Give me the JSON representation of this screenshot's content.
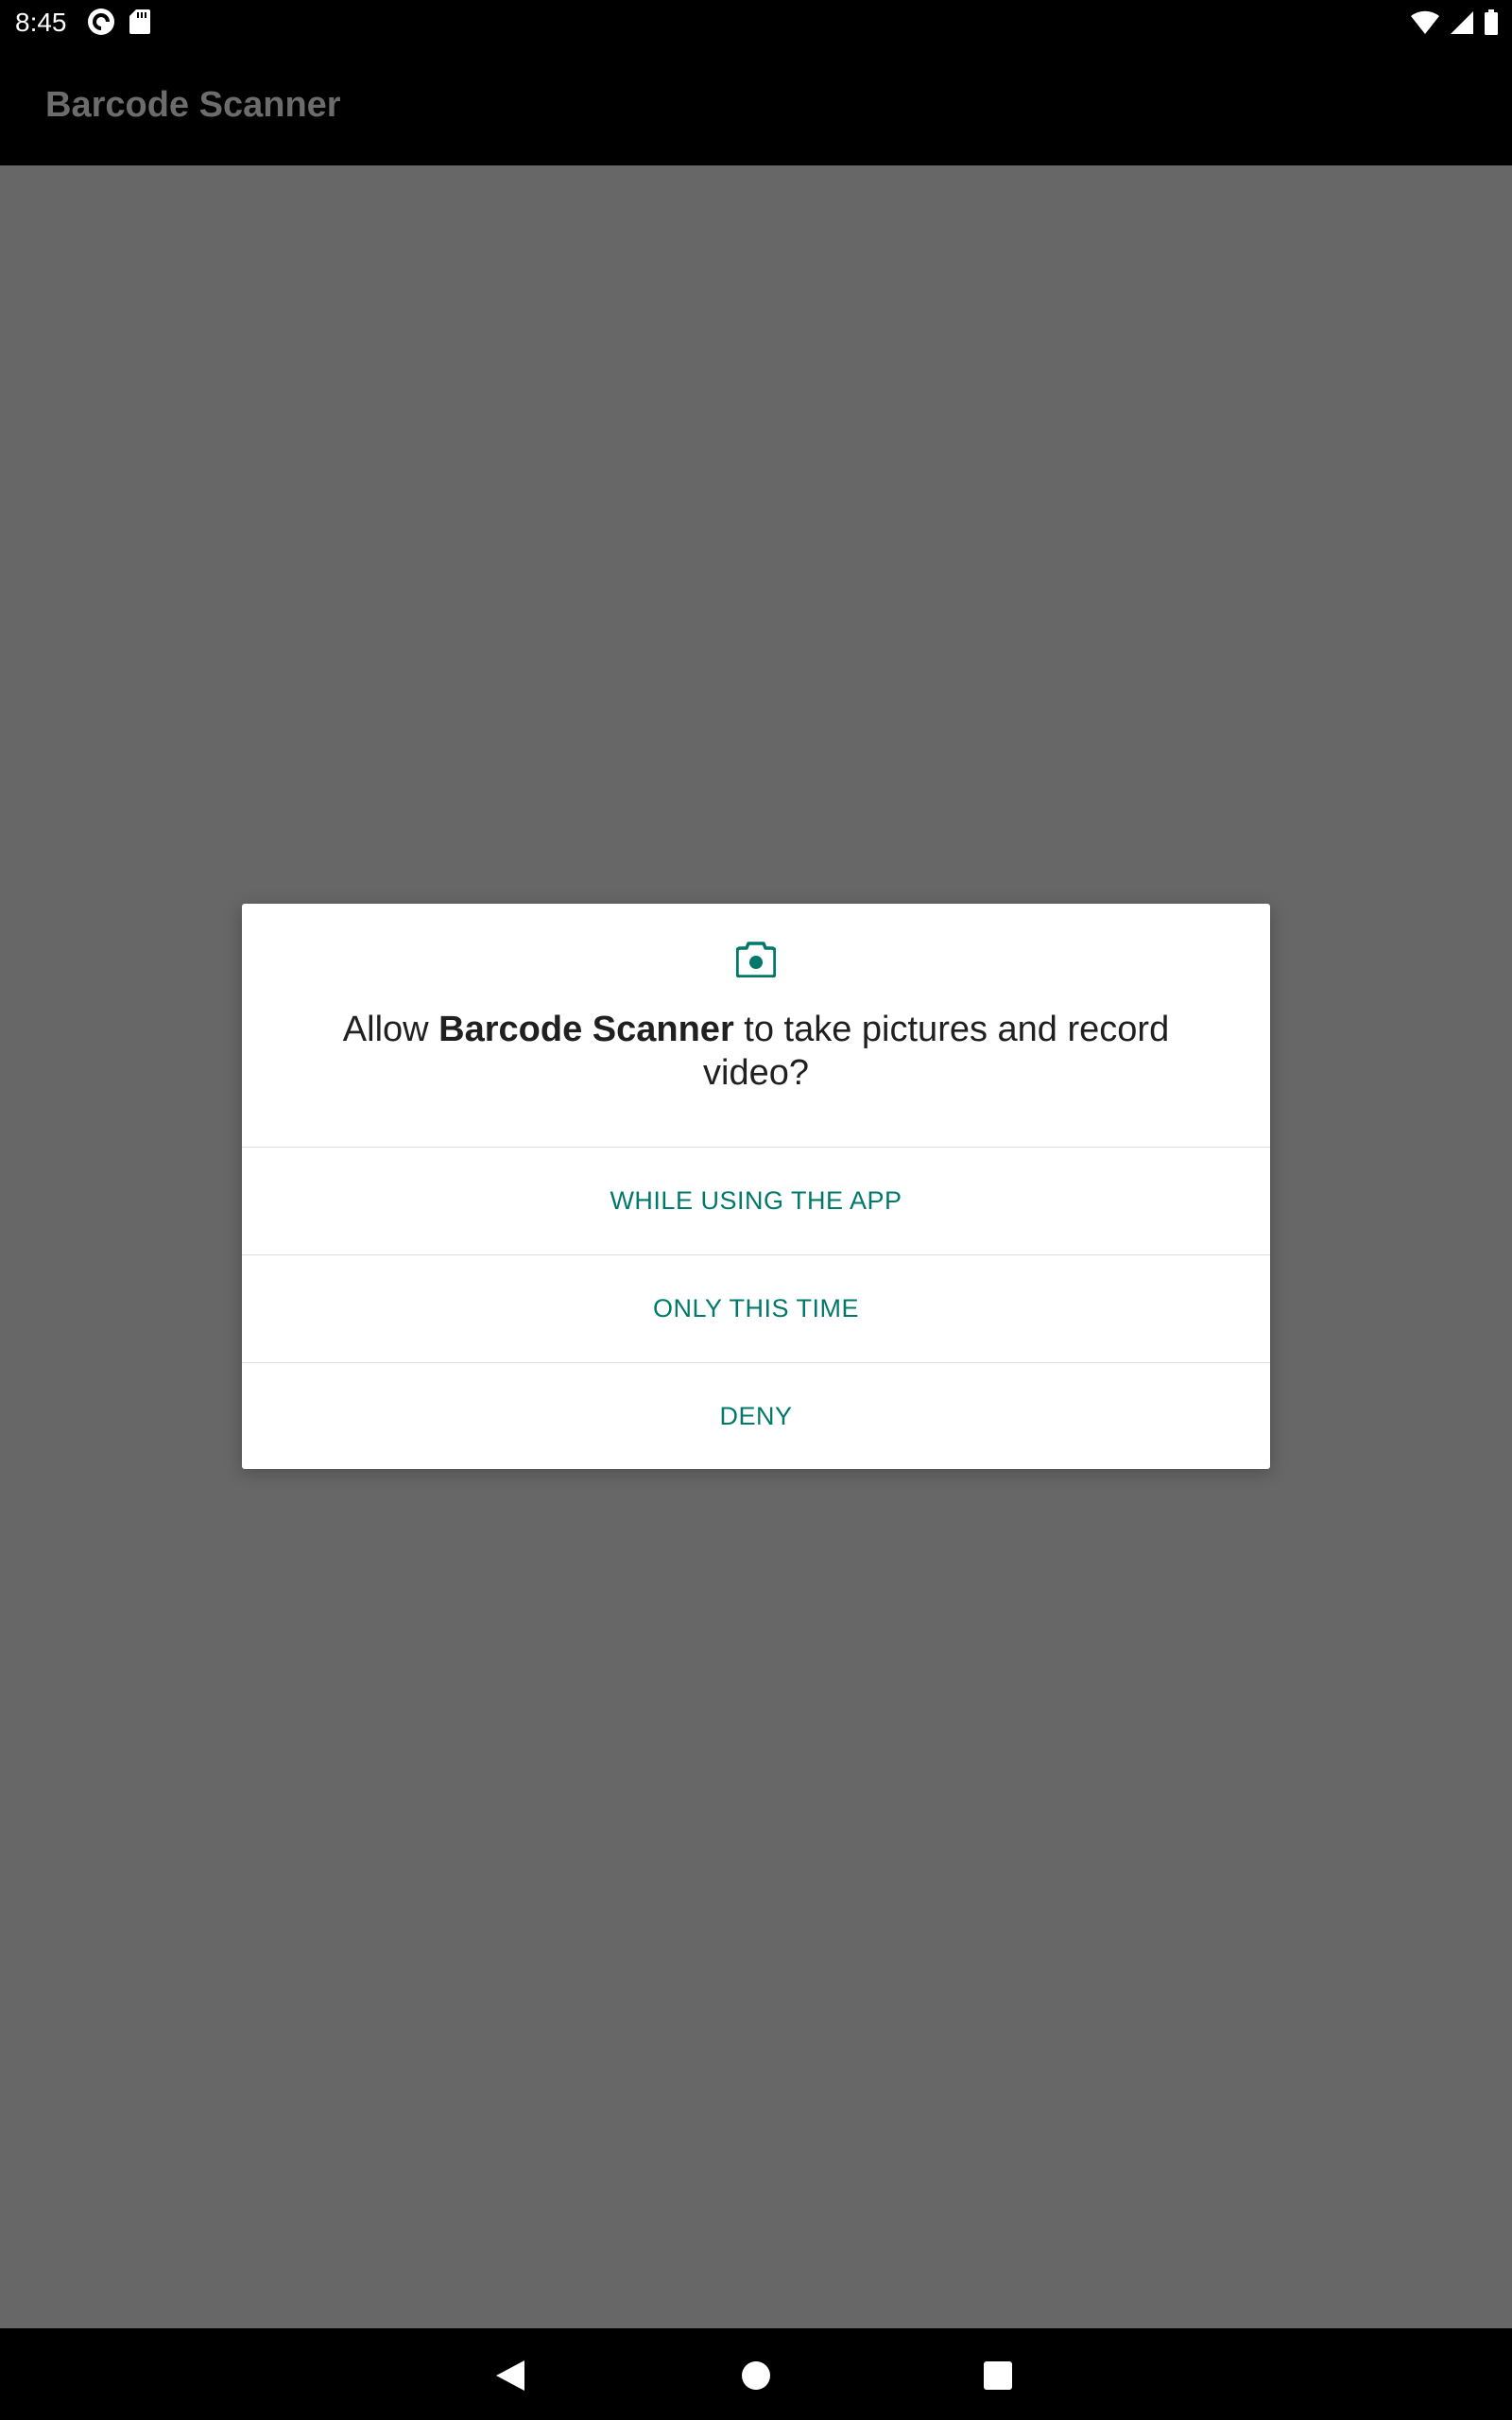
{
  "status_bar": {
    "time": "8:45",
    "left_icons": [
      "pocket-casts-icon",
      "sd-card-icon"
    ],
    "right_icons": [
      "wifi-icon",
      "signal-icon",
      "battery-icon"
    ]
  },
  "app_bar": {
    "title": "Barcode Scanner"
  },
  "dialog": {
    "icon": "camera-icon",
    "message_prefix": "Allow ",
    "message_app": "Barcode Scanner",
    "message_suffix": " to take pictures and record video?",
    "buttons": [
      {
        "label": "WHILE USING THE APP"
      },
      {
        "label": "ONLY THIS TIME"
      },
      {
        "label": "DENY"
      }
    ],
    "accent_color": "#00796b"
  },
  "nav_bar": {
    "buttons": [
      "back-icon",
      "home-icon",
      "recents-icon"
    ]
  }
}
